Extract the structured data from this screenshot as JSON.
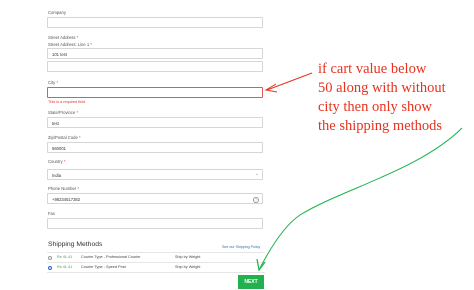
{
  "form": {
    "company": {
      "label": "Company",
      "value": ""
    },
    "street1": {
      "label": "Street Address",
      "required": true,
      "value": ""
    },
    "street2": {
      "label": "Street Address: Line 1",
      "required": true,
      "value": "101 test"
    },
    "city": {
      "label": "City",
      "required": true,
      "value": "",
      "error": "This is a required field."
    },
    "state": {
      "label": "State/Province",
      "required": true,
      "value": "test"
    },
    "zip": {
      "label": "Zip/Postal Code",
      "required": true,
      "value": "560001"
    },
    "country": {
      "label": "Country",
      "required": true,
      "value": "India"
    },
    "phone": {
      "label": "Phone Number",
      "required": true,
      "value": "+98234517382"
    },
    "fax": {
      "label": "Fax",
      "value": ""
    }
  },
  "shipping": {
    "title": "Shipping Methods",
    "policy_link": "See our Shipping Policy",
    "methods": [
      {
        "price": "Rs 41.41",
        "name": "Courier Type - Professional Courier",
        "via": "Ship by Weight",
        "selected": false
      },
      {
        "price": "Rs 41.41",
        "name": "Courier Type - Speed Post",
        "via": "Ship by Weight",
        "selected": true
      }
    ]
  },
  "next_button": {
    "label": "NEXT"
  },
  "annotation": {
    "text": "if cart value below\n50 along with without\ncity then only show\nthe shipping methods",
    "color": "#e8321e",
    "arrow_color": "#19b24a"
  },
  "colors": {
    "accent": "#22b14c",
    "error": "#e25757",
    "link": "#2a6fb6"
  }
}
